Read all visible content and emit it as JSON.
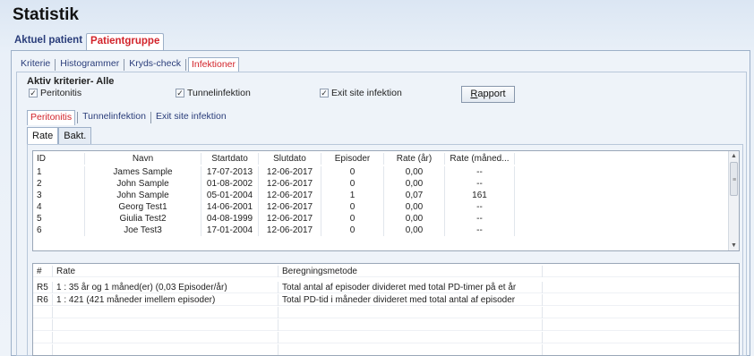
{
  "page": {
    "title": "Statistik"
  },
  "outer_tabs": [
    {
      "label": "Aktuel patient",
      "active": false
    },
    {
      "label": "Patientgruppe",
      "active": true
    }
  ],
  "sub_tabs": [
    {
      "label": "Kriterie",
      "active": false
    },
    {
      "label": "Histogrammer",
      "active": false
    },
    {
      "label": "Kryds-check",
      "active": false
    },
    {
      "label": "Infektioner",
      "active": true
    }
  ],
  "criteria": {
    "label": "Aktiv kriterier- Alle",
    "checkboxes": [
      {
        "label": "Peritonitis",
        "checked": true
      },
      {
        "label": "Tunnelinfektion",
        "checked": true
      },
      {
        "label": "Exit site infektion",
        "checked": true
      }
    ],
    "report_button": {
      "mnemonic": "R",
      "rest": "apport"
    }
  },
  "disease_tabs": [
    {
      "label": "Peritonitis",
      "active": true
    },
    {
      "label": "Tunnelinfektion",
      "active": false
    },
    {
      "label": "Exit site infektion",
      "active": false
    }
  ],
  "rate_tabs": [
    {
      "label": "Rate",
      "active": true
    },
    {
      "label": "Bakt.",
      "active": false
    }
  ],
  "patients_table": {
    "columns": [
      "ID",
      "Navn",
      "Startdato",
      "Slutdato",
      "Episoder",
      "Rate (år)",
      "Rate (måned..."
    ],
    "rows": [
      [
        "1",
        "James Sample",
        "17-07-2013",
        "12-06-2017",
        "0",
        "0,00",
        "--"
      ],
      [
        "2",
        "John Sample",
        "01-08-2002",
        "12-06-2017",
        "0",
        "0,00",
        "--"
      ],
      [
        "3",
        "John Sample",
        "05-01-2004",
        "12-06-2017",
        "1",
        "0,07",
        "161"
      ],
      [
        "4",
        "Georg Test1",
        "14-06-2001",
        "12-06-2017",
        "0",
        "0,00",
        "--"
      ],
      [
        "5",
        "Giulia Test2",
        "04-08-1999",
        "12-06-2017",
        "0",
        "0,00",
        "--"
      ],
      [
        "6",
        "Joe Test3",
        "17-01-2004",
        "12-06-2017",
        "0",
        "0,00",
        "--"
      ]
    ]
  },
  "rates_table": {
    "columns": [
      "#",
      "Rate",
      "Beregningsmetode"
    ],
    "rows": [
      [
        "R5",
        "1 : 35 år og 1 måned(er) (0,03 Episoder/år)",
        "Total antal af episoder divideret med total PD-timer på et år"
      ],
      [
        "R6",
        "1 : 421 (421 måneder imellem episoder)",
        "Total PD-tid i måneder divideret med total antal af episoder"
      ]
    ]
  },
  "scrollbar": {
    "up": "▲",
    "down": "▼",
    "grip": "≡"
  },
  "check_glyph": "✓"
}
